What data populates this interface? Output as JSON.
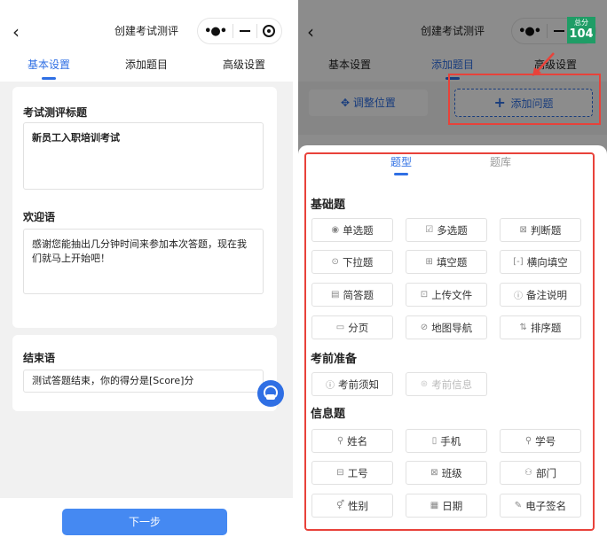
{
  "left": {
    "nav_title": "创建考试测评",
    "tabs": [
      "基本设置",
      "添加题目",
      "高级设置"
    ],
    "title_label": "考试测评标题",
    "title_value": "新员工入职培训考试",
    "welcome_label": "欢迎语",
    "welcome_value": "感谢您能抽出几分钟时间来参加本次答题，现在我们就马上开始吧！",
    "ending_label": "结束语",
    "ending_value": "测试答题结束，你的得分是[Score]分",
    "next_label": "下一步"
  },
  "right": {
    "nav_title": "创建考试测评",
    "tabs": [
      "基本设置",
      "添加题目",
      "高级设置"
    ],
    "adjust_label": "调整位置",
    "add_label": "添加问题",
    "score_label": "总分",
    "score_value": "104",
    "sheet_tabs": [
      "题型",
      "题库"
    ],
    "sections": [
      "基础题",
      "考前准备",
      "信息题"
    ],
    "basic": [
      "单选题",
      "多选题",
      "判断题",
      "下拉题",
      "填空题",
      "横向填空",
      "简答题",
      "上传文件",
      "备注说明",
      "分页",
      "地图导航",
      "排序题"
    ],
    "prep": [
      "考前须知",
      "考前信息"
    ],
    "info": [
      "姓名",
      "手机",
      "学号",
      "工号",
      "班级",
      "部门",
      "性别",
      "日期",
      "电子签名"
    ]
  },
  "colors": {
    "accent": "#2f6fe4",
    "highlight": "#e8423a",
    "score_bg": "#1f9d66"
  }
}
